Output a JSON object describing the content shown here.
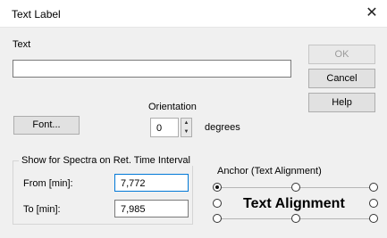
{
  "window": {
    "title": "Text Label",
    "close_glyph": "✕"
  },
  "text_section": {
    "label": "Text",
    "value": ""
  },
  "buttons": {
    "ok": "OK",
    "cancel": "Cancel",
    "help": "Help",
    "font": "Font..."
  },
  "orientation": {
    "label": "Orientation",
    "value": "0",
    "unit": "degrees"
  },
  "spectra": {
    "title": "Show for Spectra on Ret. Time Interval",
    "from_label": "From [min]:",
    "from_value": "7,772",
    "to_label": "To [min]:",
    "to_value": "7,985"
  },
  "anchor": {
    "title": "Anchor (Text Alignment)",
    "preview": "Text Alignment",
    "selected": "top-left"
  },
  "colors": {
    "focus_border": "#0078d7",
    "disabled_text": "#9a9a9a",
    "dialog_bg": "#f0f0f0"
  }
}
